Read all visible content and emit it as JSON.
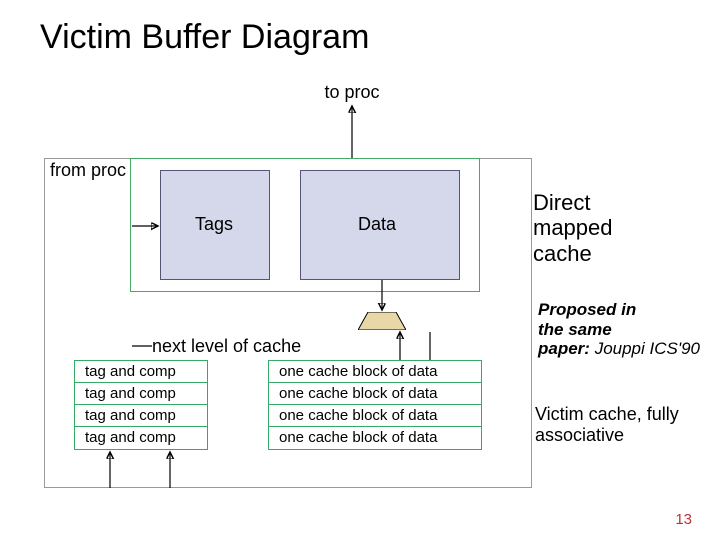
{
  "title": "Victim Buffer Diagram",
  "labels": {
    "to_proc": "to proc",
    "from_proc": "from proc",
    "tags": "Tags",
    "data": "Data",
    "direct_mapped": "Direct\nmapped\ncache",
    "next_level": "next level of cache",
    "proposed_line1": "Proposed in",
    "proposed_line2": "the same",
    "proposed_line3": "paper:",
    "proposed_ref": " Jouppi ICS'90",
    "victim_cache": "Victim cache, fully\nassociative"
  },
  "victim_tags": [
    "tag and comp",
    "tag and comp",
    "tag and comp",
    "tag and comp"
  ],
  "victim_data": [
    "one cache block of data",
    "one cache block of data",
    "one cache block of data",
    "one cache block of data"
  ],
  "page_number": "13",
  "chart_data": {
    "type": "table",
    "description": "Block diagram of a direct-mapped cache with an attached fully-associative victim buffer (Jouppi ICS'90).",
    "direct_mapped_cache": {
      "fields": [
        "Tags",
        "Data"
      ]
    },
    "victim_cache": {
      "associativity": "fully associative",
      "entries": 4,
      "per_entry": {
        "tag": "tag and comp",
        "data": "one cache block of data"
      }
    },
    "flows": [
      "from proc → Tags (lookup)",
      "Data → to proc",
      "Data → mux → next level of cache",
      "victim data blocks → mux",
      "outer box → victim tag table (fill on eviction)"
    ],
    "reference": "Jouppi ICS'90"
  }
}
